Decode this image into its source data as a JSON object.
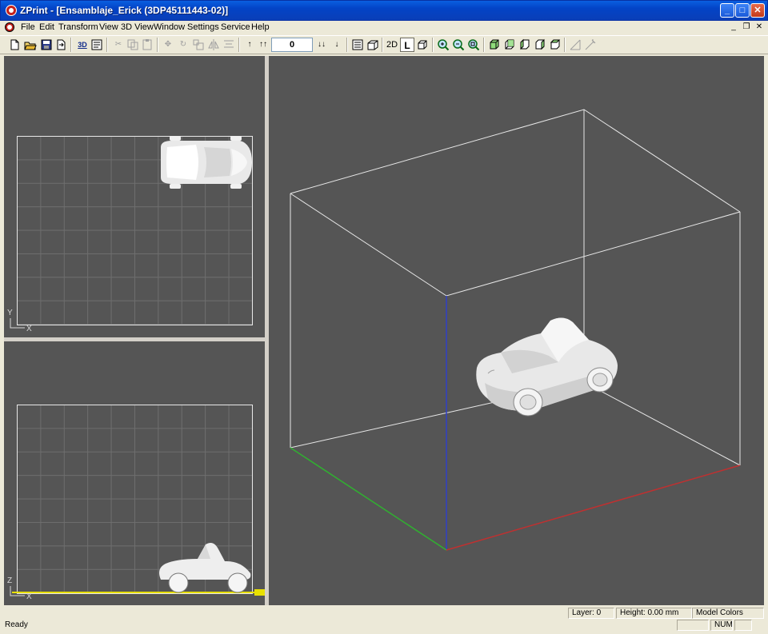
{
  "window": {
    "title": "ZPrint - [Ensamblaje_Erick (3DP45111443-02)]",
    "buttons": {
      "minimize": "_",
      "maximize": "□",
      "close": "✕"
    }
  },
  "menubar": {
    "items": [
      "File",
      "Edit",
      "Transform",
      "View",
      "3D View",
      "Window",
      "Settings",
      "Service",
      "Help"
    ],
    "mdi": {
      "minimize": "_",
      "restore": "❐",
      "close": "✕"
    }
  },
  "toolbar": {
    "layer_value": "0",
    "view_2d_label": "2D",
    "view_l_label": "L",
    "view_3d_label": "3D"
  },
  "views": {
    "top": {
      "axis_v": "Y",
      "axis_h": "X"
    },
    "front": {
      "axis_v": "Z",
      "axis_h": "X"
    }
  },
  "statusbar": {
    "ready": "Ready",
    "layer": "Layer: 0",
    "height": "Height: 0.00 mm",
    "colors": "Model Colors",
    "num": "NUM"
  },
  "colors": {
    "viewport_bg": "#555555",
    "axis_x": "#c03030",
    "axis_y": "#30b030",
    "axis_z": "#3040c8",
    "build_line": "#e8e000"
  }
}
